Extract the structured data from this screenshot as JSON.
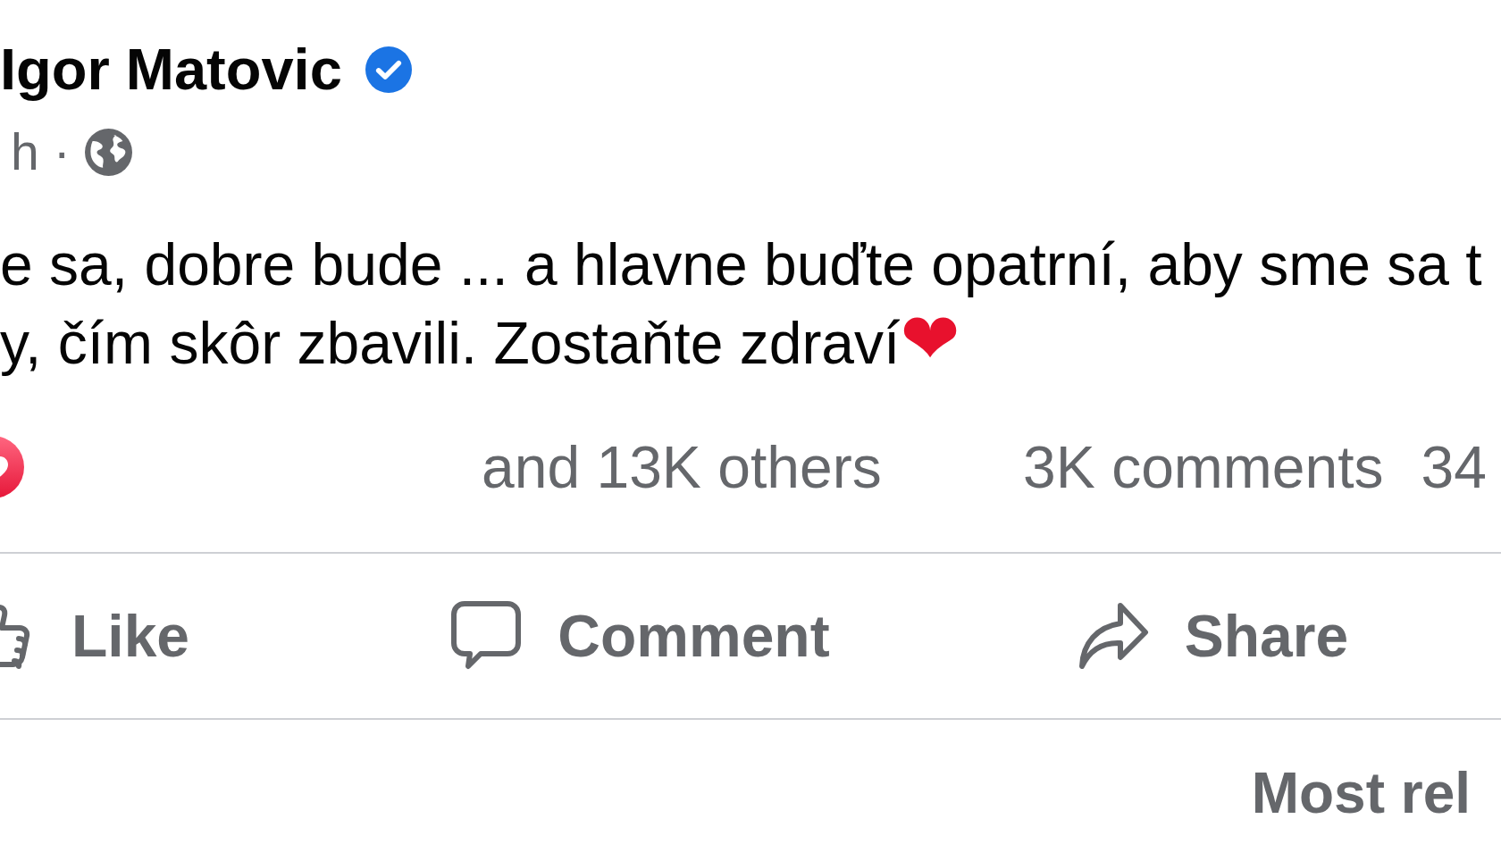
{
  "post": {
    "author": {
      "name": "Igor Matovic",
      "verified": true
    },
    "time": "h",
    "separator": "·",
    "audience": {
      "kind": "public"
    },
    "text": "e sa, dobre bude ... a hlavne buďte opatrní, aby sme sa t\ny, čím skôr zbavili. Zostaňte zdraví",
    "emoji": "❤"
  },
  "reactions": {
    "icons": [
      {
        "kind": "love"
      }
    ],
    "summary": "and 13K others",
    "comments": "3K comments",
    "shares": "34"
  },
  "actions": [
    {
      "kind": "like",
      "label": "Like"
    },
    {
      "kind": "comment",
      "label": "Comment"
    },
    {
      "kind": "share",
      "label": "Share"
    }
  ],
  "comment_sort": "Most rel"
}
